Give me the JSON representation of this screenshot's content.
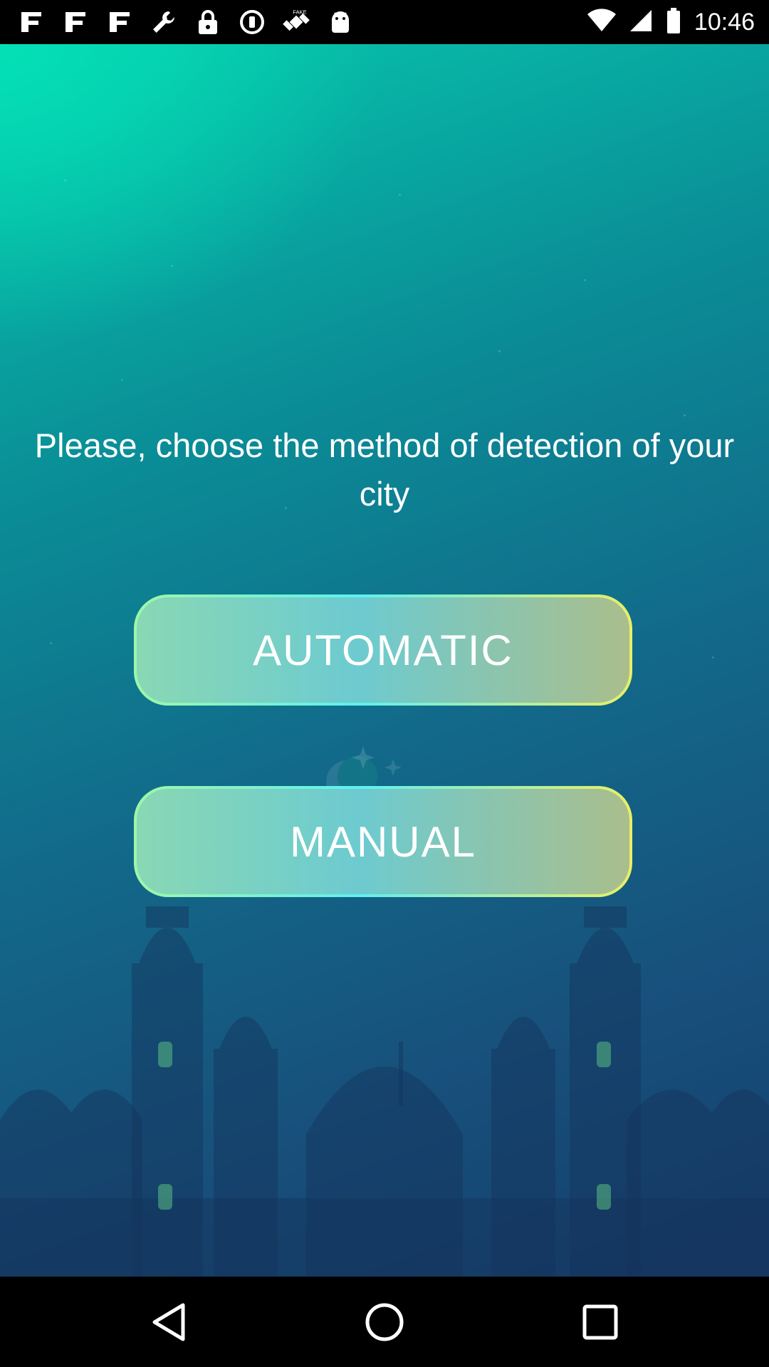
{
  "status_bar": {
    "time": "10:46",
    "left_icons": [
      "app-notification-icon",
      "app-notification-icon",
      "app-notification-icon",
      "wrench-icon",
      "lock-icon",
      "circle-badge-icon",
      "fake-gps-satellite-icon",
      "android-icon"
    ],
    "right_icons": [
      "wifi-icon",
      "signal-icon",
      "battery-icon"
    ]
  },
  "main": {
    "prompt": "Please, choose the method of detection of your city",
    "automatic_label": "AUTOMATIC",
    "manual_label": "MANUAL"
  },
  "nav_bar": {
    "icons": [
      "back-icon",
      "home-icon",
      "recents-icon"
    ]
  },
  "colors": {
    "gradient_top": "#04e0b6",
    "gradient_bottom": "#163e6c",
    "button_border_left": "#9ef7a8",
    "button_border_mid": "#5ff0f0",
    "button_border_right": "#e9ef66"
  }
}
